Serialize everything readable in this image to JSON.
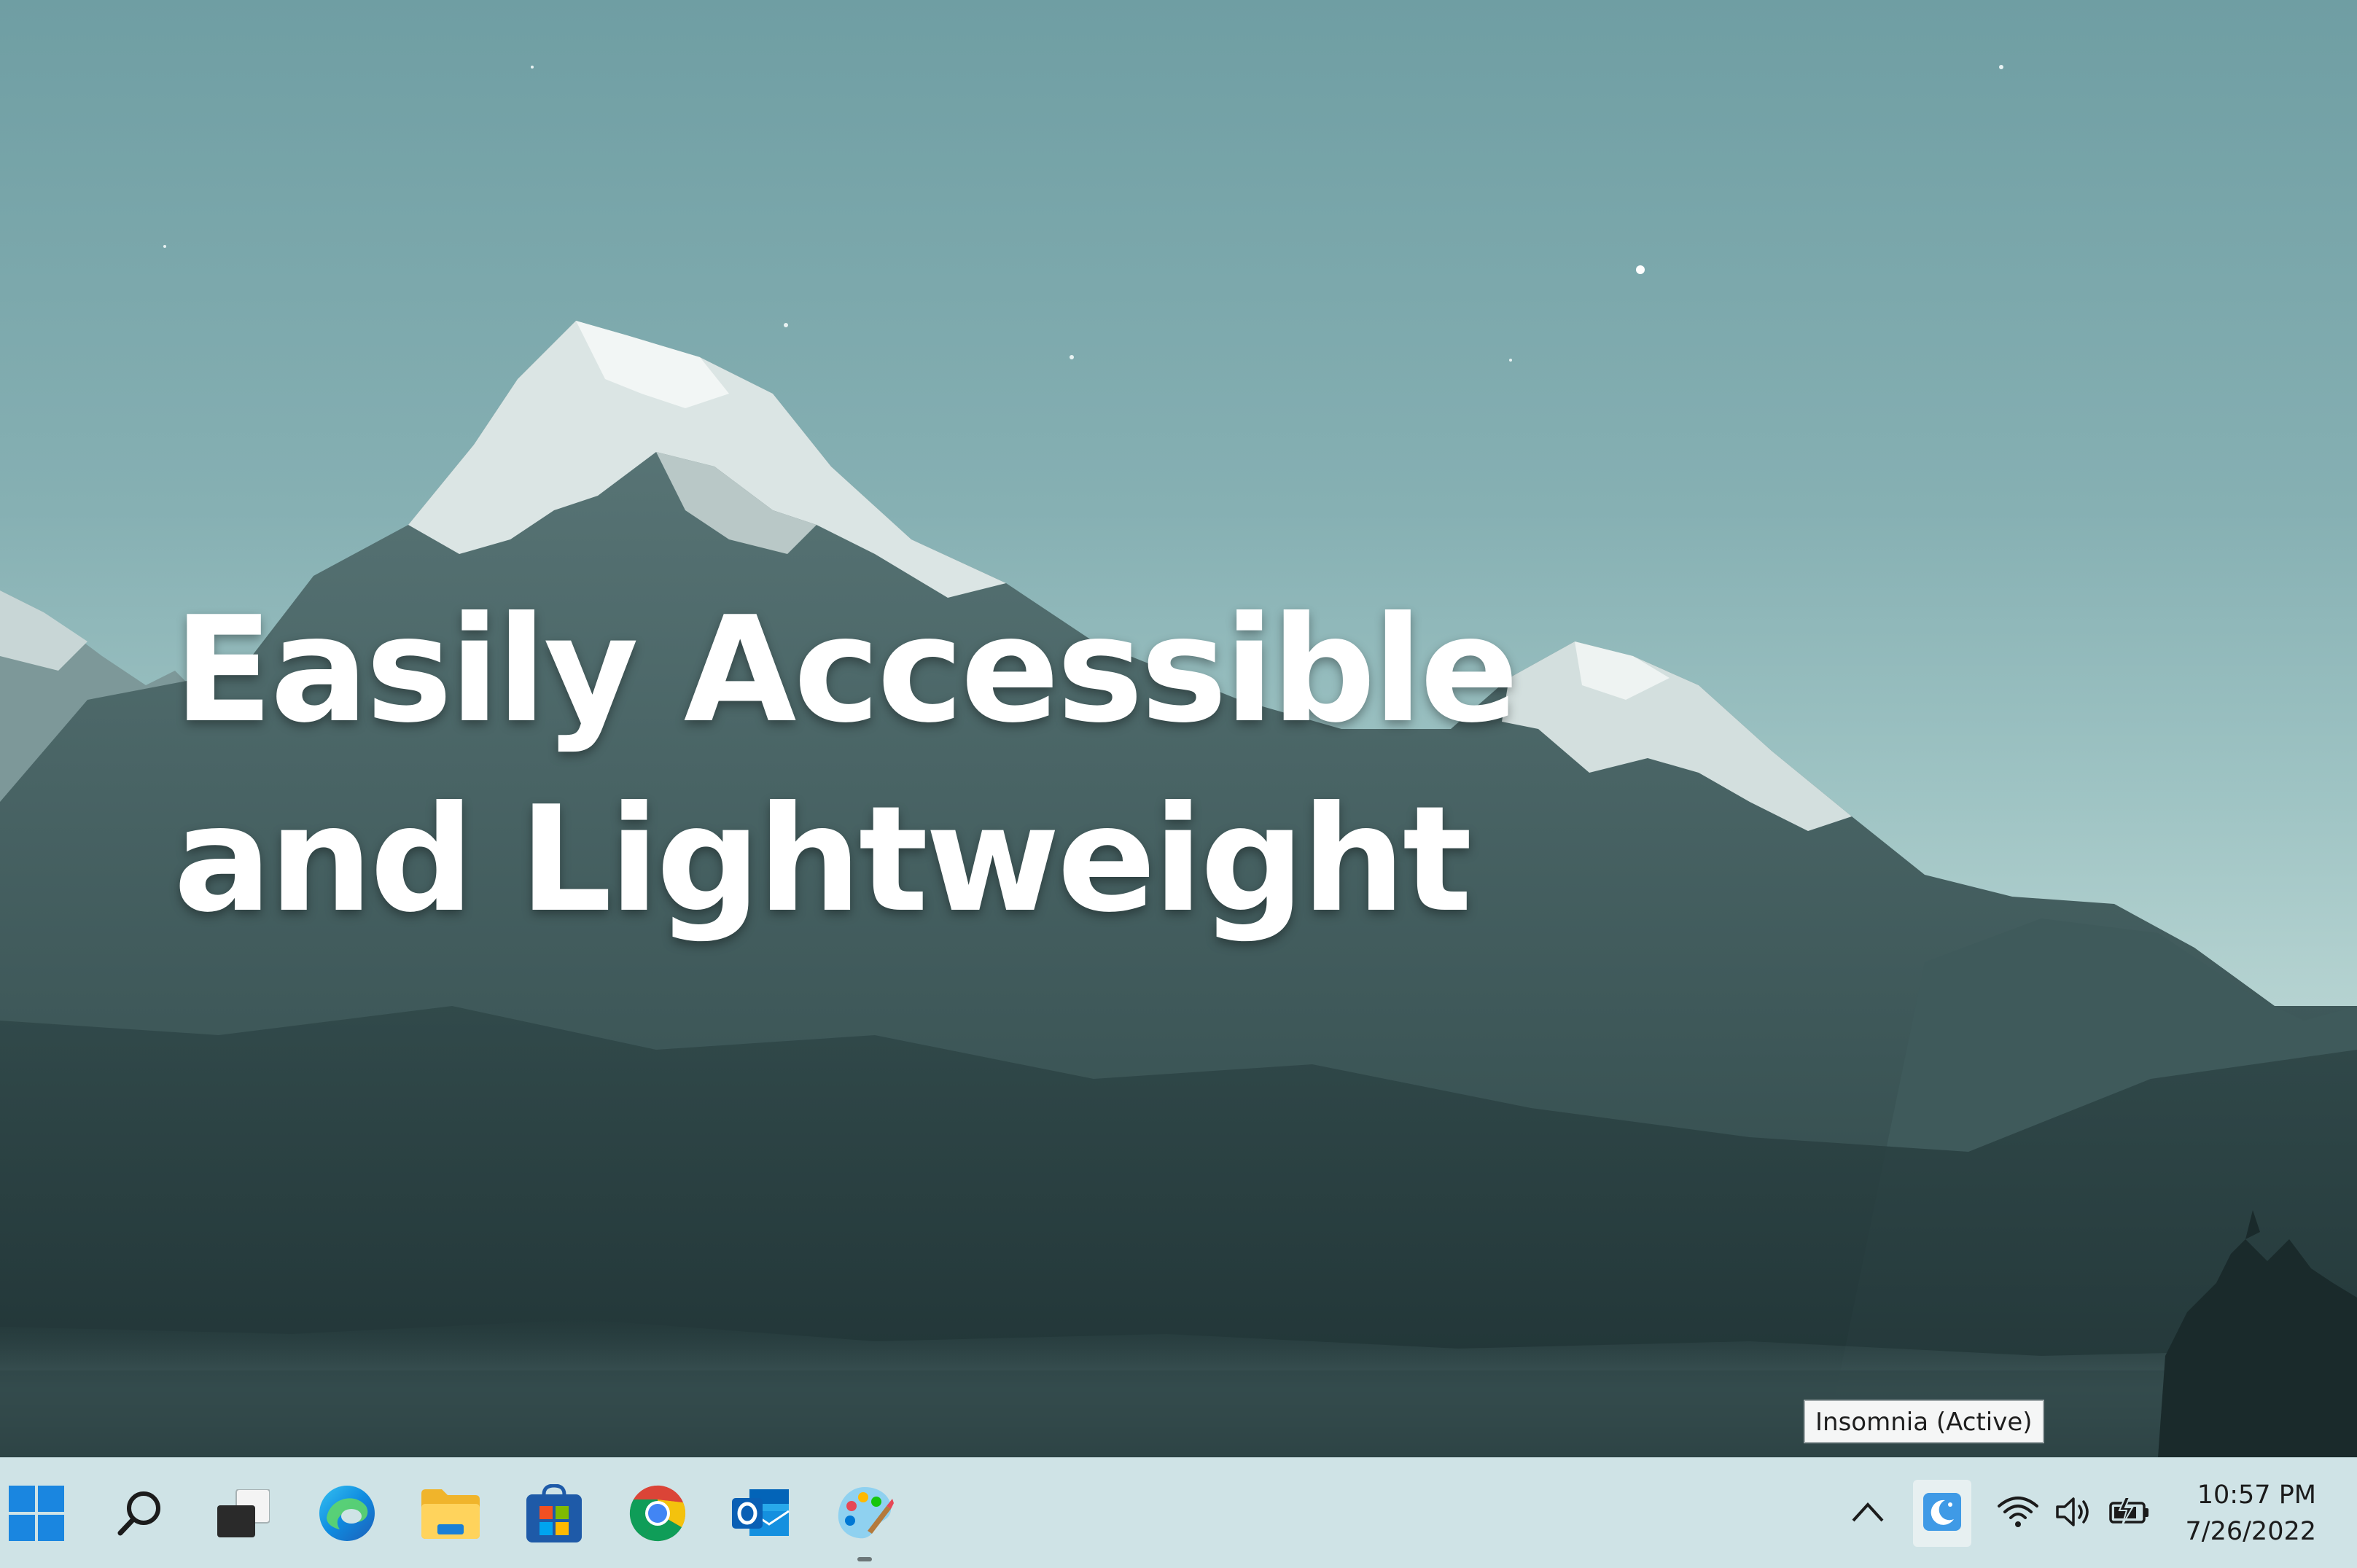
{
  "desktop": {
    "hero_line_1": "Easily Accessible",
    "hero_line_2": "and Lightweight"
  },
  "tooltip": {
    "text": "Insomnia (Active)"
  },
  "taskbar": {
    "apps": [
      {
        "name": "Start",
        "icon": "windows-start-icon"
      },
      {
        "name": "Search",
        "icon": "search-icon"
      },
      {
        "name": "Task View",
        "icon": "task-view-icon"
      },
      {
        "name": "Microsoft Edge",
        "icon": "edge-icon"
      },
      {
        "name": "File Explorer",
        "icon": "folder-icon"
      },
      {
        "name": "Microsoft Store",
        "icon": "store-icon"
      },
      {
        "name": "Google Chrome",
        "icon": "chrome-icon"
      },
      {
        "name": "Outlook",
        "icon": "outlook-icon"
      },
      {
        "name": "Paint",
        "icon": "paint-icon"
      }
    ],
    "tray": {
      "overflow_icon": "chevron-up-icon",
      "insomnia_icon": "moon-icon",
      "wifi_icon": "wifi-icon",
      "volume_icon": "volume-icon",
      "battery_icon": "battery-charging-icon"
    },
    "clock": {
      "time": "10:57 PM",
      "date": "7/26/2022"
    }
  },
  "colors": {
    "taskbar_bg": "#cfe3e6",
    "sky_top": "#6f9ea3",
    "sky_bottom": "#c5dcd8",
    "accent": "#0078d4"
  }
}
